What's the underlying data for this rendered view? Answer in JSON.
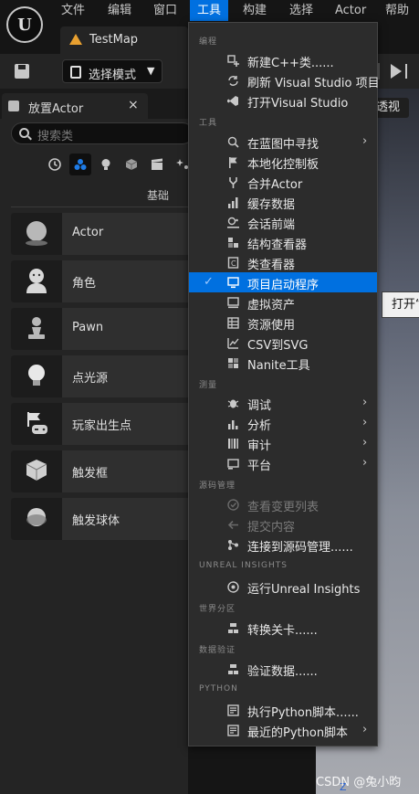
{
  "menubar": {
    "items": [
      "文件",
      "编辑",
      "窗口",
      "工具",
      "构建",
      "选择",
      "Actor",
      "帮助"
    ],
    "active": "工具"
  },
  "level_tab": {
    "name": "TestMap"
  },
  "toolbar": {
    "mode_label": "选择模式"
  },
  "panel": {
    "title": "放置Actor",
    "close": "×",
    "search_placeholder": "搜索类",
    "category_label": "基础",
    "actors": [
      "Actor",
      "角色",
      "Pawn",
      "点光源",
      "玩家出生点",
      "触发框",
      "触发球体"
    ]
  },
  "viewport": {
    "perspective_label": "透视",
    "tooltip_text": "打开“",
    "axis_label": "Z"
  },
  "watermark": "CSDN @兔小昀",
  "dropdown": {
    "sections": {
      "programming": "编程",
      "tools": "工具",
      "instrumentation": "测量",
      "source_control": "源码管理",
      "insights": "UNREAL INSIGHTS",
      "world_partition": "世界分区",
      "data_validation": "数据验证",
      "python": "PYTHON"
    },
    "items": {
      "new_cpp": "新建C++类......",
      "refresh_vs": "刷新 Visual Studio 项目",
      "open_vs": "打开Visual Studio",
      "find_in_bp": "在蓝图中寻找",
      "localization": "本地化控制板",
      "merge_actor": "合并Actor",
      "cache_data": "缓存数据",
      "session_frontend": "会话前端",
      "struct_viewer": "结构查看器",
      "class_viewer": "类查看器",
      "project_launcher": "项目启动程序",
      "virtual_assets": "虚拟资产",
      "resource_usage": "资源使用",
      "csv_to_svg": "CSV到SVG",
      "nanite_tools": "Nanite工具",
      "debug": "调试",
      "profile": "分析",
      "audit": "审计",
      "platform": "平台",
      "view_changelists": "查看变更列表",
      "submit_content": "提交内容",
      "connect_source_control": "连接到源码管理......",
      "run_insights": "运行Unreal Insights",
      "convert_level": "转换关卡......",
      "validate_data": "验证数据......",
      "execute_python": "执行Python脚本......",
      "recent_python": "最近的Python脚本"
    }
  }
}
